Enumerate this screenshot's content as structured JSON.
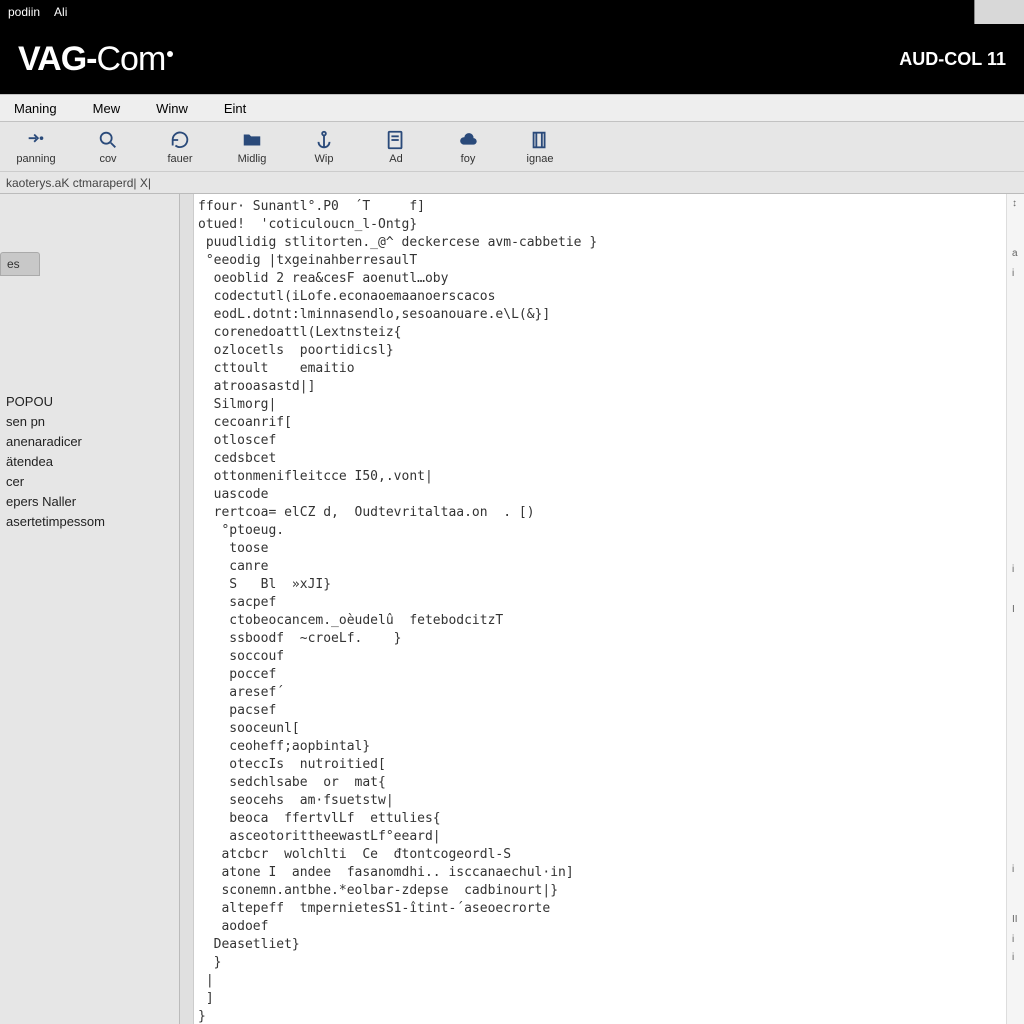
{
  "window": {
    "title_left": "podiin",
    "title_right": "Ali"
  },
  "brand": {
    "heavy": "VAG",
    "dash": "-",
    "light": "Com"
  },
  "top_right": "AUD-COL 11",
  "menu": [
    "Maning",
    "Mew",
    "Winw",
    "Eint"
  ],
  "toolbar": [
    {
      "label": "panning",
      "icon": "arrow-icon"
    },
    {
      "label": "cov",
      "icon": "search-icon"
    },
    {
      "label": "fauer",
      "icon": "refresh-icon"
    },
    {
      "label": "Midlig",
      "icon": "folder-icon"
    },
    {
      "label": "Wip",
      "icon": "anchor-icon"
    },
    {
      "label": "Ad",
      "icon": "page-icon"
    },
    {
      "label": "foy",
      "icon": "cloud-icon"
    },
    {
      "label": "ignae",
      "icon": "box-icon"
    }
  ],
  "tab_label": "kaoterys.aK ctmaraperd| X|",
  "sidebar": {
    "box": "es",
    "items": [
      "POPOU",
      "sen pn",
      "anenaradicer",
      "ätendea",
      "cer",
      "epers Naller",
      "asertetimpessom"
    ]
  },
  "code_lines": [
    "ffour· Sunantl°.P0  ´T     f]",
    "otued!  'coticuloucn_l-Ontg}",
    " puudlidig stlitorten._@^ deckercese avm-cabbetie }",
    " °eeodig |txgeinahberresaulT",
    "  oeoblid 2 rea&cesF aoenutl…oby",
    "  codectutl(iLofe.econaoemaanoerscacos",
    "  eodL.dotnt:lminnasendlo,sesoanouare.e\\L(&}]",
    "  corenedoattl(Lextnsteiz{",
    "  ozlocetls  poortidicsl}",
    "  cttoult    emaitio",
    "  atrooasastd|]",
    "  Silmorg|",
    "  cecoanrif[",
    "  otloscef",
    "  cedsbcet",
    "  ottonmenifleitcce I50,.vont|",
    "  uascode",
    "  rertcoa= elCZ d,  Oudtevritaltaa.on  . [)",
    "   °ptoeug.",
    "    toose",
    "    canre",
    "    S   Bl  »xJI}",
    "    sacpef",
    "    ctobeocancem._oèudelû  fetebodcitzT",
    "    ssboodf  ~croeLf.    }",
    "    soccouf",
    "    poccef",
    "    aresef´",
    "    pacsef",
    "    sooceunl[",
    "    ceoheff;aopbintal}",
    "    oteccIs  nutroitied[",
    "    sedchlsabe  or  mat{",
    "    seocehs  am·fsuetstw|",
    "    beoca  ffertvlLf  ettulies{",
    "    asceotorittheewastLf°eeard|",
    "   atcbcr  wolchlti  Ce  đtontcogeordl-S",
    "   atone I  andee  fasanomdhi.. isccanaechul·in]",
    "   sconemn.antbhe.*eolbar-zdepse  cadbinourt|}",
    "   altepeff  tmpernietesS1-îtint-´aseoecrorte",
    "   aodoef",
    "  Deasetliet}",
    "  }",
    " |",
    " ]",
    "}"
  ],
  "right_ticks": [
    "↕",
    "a",
    "i",
    "i",
    "I",
    "i",
    "II",
    "i",
    "i"
  ]
}
